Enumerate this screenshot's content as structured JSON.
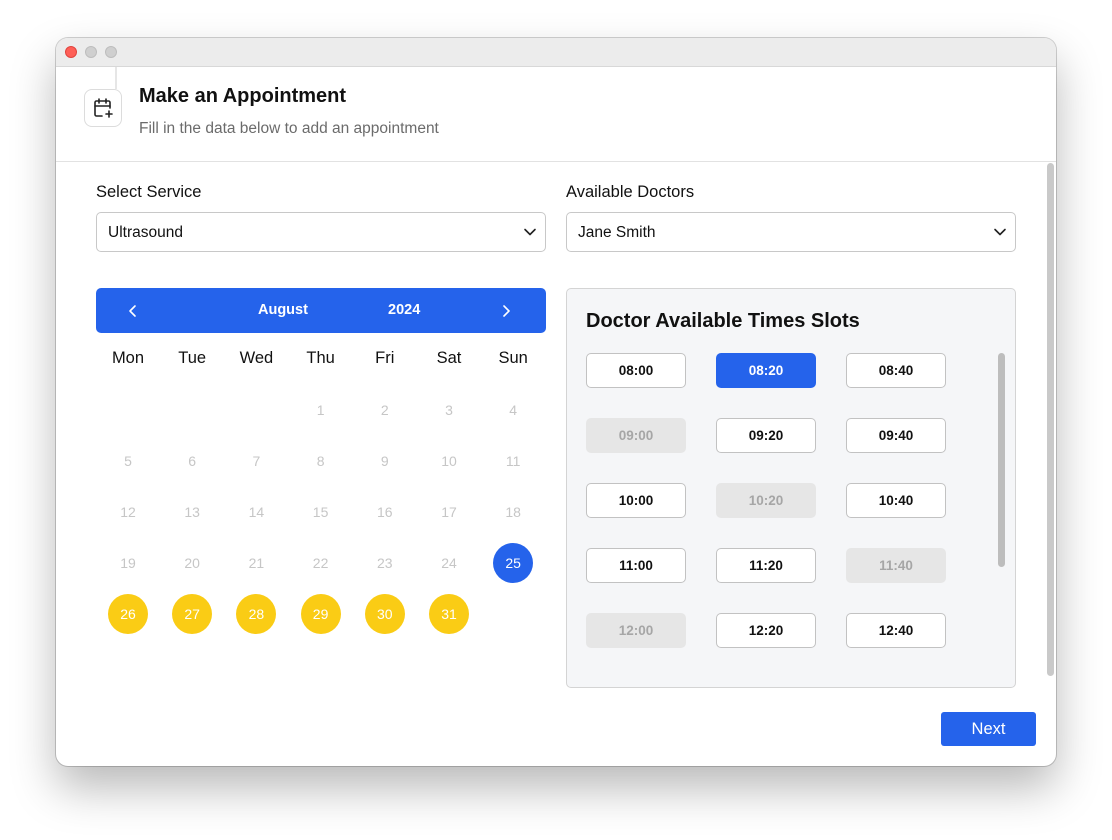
{
  "header": {
    "title": "Make an Appointment",
    "subtitle": "Fill in the data below to add an appointment",
    "icon": "calendar-plus-icon"
  },
  "form": {
    "service_label": "Select Service",
    "service_value": "Ultrasound",
    "doctor_label": "Available Doctors",
    "doctor_value": "Jane Smith"
  },
  "calendar": {
    "month": "August",
    "year": "2024",
    "weekdays": [
      "Mon",
      "Tue",
      "Wed",
      "Thu",
      "Fri",
      "Sat",
      "Sun"
    ],
    "first_day_column": 3,
    "days_in_month": 31,
    "selected_day": 25,
    "available_days": [
      26,
      27,
      28,
      29,
      30,
      31
    ],
    "accent_color": "#2563eb",
    "available_color": "#facc15"
  },
  "slots": {
    "title": "Doctor Available Times Slots",
    "items": [
      {
        "time": "08:00",
        "state": "available"
      },
      {
        "time": "08:20",
        "state": "selected"
      },
      {
        "time": "08:40",
        "state": "available"
      },
      {
        "time": "09:00",
        "state": "disabled"
      },
      {
        "time": "09:20",
        "state": "available"
      },
      {
        "time": "09:40",
        "state": "available"
      },
      {
        "time": "10:00",
        "state": "available"
      },
      {
        "time": "10:20",
        "state": "disabled"
      },
      {
        "time": "10:40",
        "state": "available"
      },
      {
        "time": "11:00",
        "state": "available"
      },
      {
        "time": "11:20",
        "state": "available"
      },
      {
        "time": "11:40",
        "state": "disabled"
      },
      {
        "time": "12:00",
        "state": "disabled"
      },
      {
        "time": "12:20",
        "state": "available"
      },
      {
        "time": "12:40",
        "state": "available"
      }
    ]
  },
  "footer": {
    "next_label": "Next"
  }
}
